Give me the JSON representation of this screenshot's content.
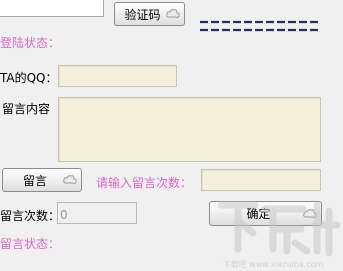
{
  "top_field": {
    "value": ""
  },
  "verify_button": {
    "label": "验证码"
  },
  "captcha": {
    "text": ""
  },
  "login_status": {
    "label": "登陆状态：",
    "value": ""
  },
  "ta_qq": {
    "label": "TA的QQ：",
    "value": ""
  },
  "message_content": {
    "label": "留言内容",
    "value": ""
  },
  "leave_message_button": {
    "label": "留言"
  },
  "count_prompt": {
    "label": "请输入留言次数：",
    "value": ""
  },
  "message_count": {
    "label": "留言次数：",
    "value": "0"
  },
  "confirm_button": {
    "label": "确定"
  },
  "message_status": {
    "label": "留言状态：",
    "value": ""
  },
  "watermark": {
    "text": "下载吧 www.xiazaiba.com"
  },
  "colors": {
    "status_label": "#d868c8",
    "field_bg": "#f3f0dc",
    "window_bg": "#f0f0f0"
  }
}
